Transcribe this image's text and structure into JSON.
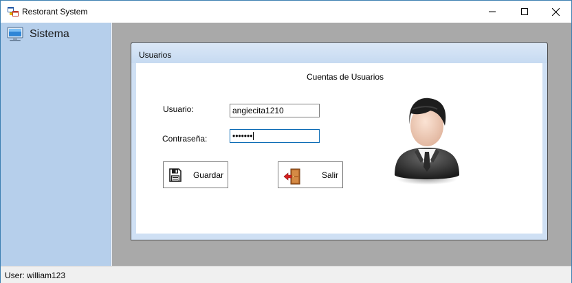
{
  "window": {
    "title": "Restorant System",
    "icon": "app-window-icon",
    "controls": [
      "minimize-icon",
      "maximize-icon",
      "close-icon"
    ]
  },
  "sidebar": {
    "items": [
      {
        "label": "Sistema",
        "icon": "monitor-icon"
      }
    ]
  },
  "child_window": {
    "title": "Usuarios",
    "heading": "Cuentas de Usuarios",
    "fields": {
      "user_label": "Usuario:",
      "user_value": "angiecita1210",
      "password_label": "Contraseña:",
      "password_value": "•••••••"
    },
    "buttons": {
      "save_label": "Guardar",
      "exit_label": "Salir"
    }
  },
  "status": {
    "text": "User: william123"
  },
  "colors": {
    "sidebar_bg": "#b6cfeb",
    "mdi_bg": "#a9a9a9",
    "child_frame": "#cfe0f4",
    "focus_border": "#0b6bb5"
  }
}
